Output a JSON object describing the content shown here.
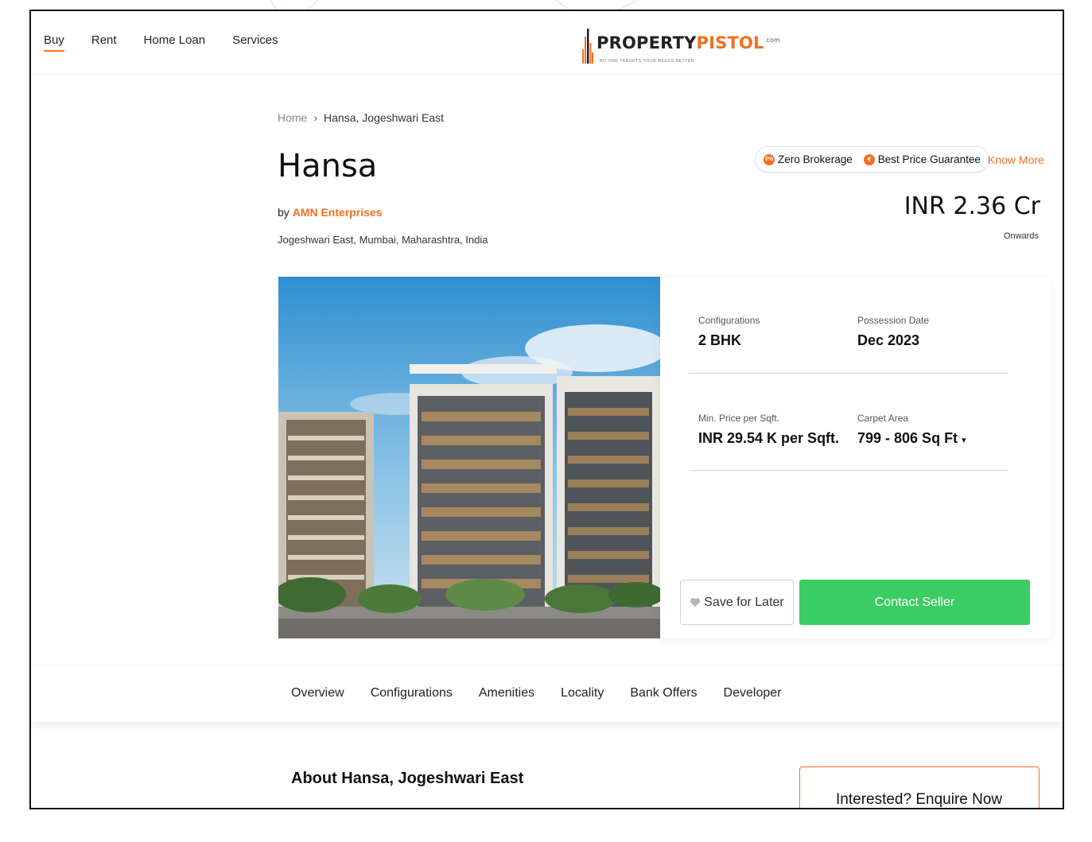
{
  "nav": {
    "items": [
      {
        "label": "Buy",
        "active": true
      },
      {
        "label": "Rent",
        "active": false
      },
      {
        "label": "Home Loan",
        "active": false
      },
      {
        "label": "Services",
        "active": false
      }
    ]
  },
  "logo": {
    "text_main": "PROPERTY",
    "text_accent": "PISTOL",
    "suffix": ".com",
    "tagline": "NO ONE TARGETS YOUR NEEDS BETTER"
  },
  "breadcrumb": {
    "home": "Home",
    "separator": "›",
    "current": "Hansa, Jogeshwari East"
  },
  "project": {
    "title": "Hansa",
    "by_prefix": "by",
    "developer": "AMN Enterprises",
    "location": "Jogeshwari East, Mumbai, Maharashtra, India"
  },
  "badges": {
    "zero_brokerage": "Zero Brokerage",
    "best_price": "Best Price Guarantee",
    "know_more": "Know More"
  },
  "price": {
    "value": "INR 2.36 Cr",
    "sub": "Onwards"
  },
  "info": {
    "configurations_label": "Configurations",
    "configurations_value": "2 BHK",
    "possession_label": "Possession Date",
    "possession_value": "Dec 2023",
    "min_price_label": "Min. Price per Sqft.",
    "min_price_value": "INR 29.54 K per Sqft.",
    "carpet_label": "Carpet Area",
    "carpet_value": "799 - 806 Sq Ft"
  },
  "actions": {
    "save_label": "Save for Later",
    "contact_label": "Contact Seller"
  },
  "tabs": [
    "Overview",
    "Configurations",
    "Amenities",
    "Locality",
    "Bank Offers",
    "Developer"
  ],
  "about": {
    "heading": "About Hansa, Jogeshwari East"
  },
  "enquire": {
    "label": "Interested? Enquire Now"
  },
  "colors": {
    "accent": "#f37021",
    "contact": "#3ccc64"
  }
}
